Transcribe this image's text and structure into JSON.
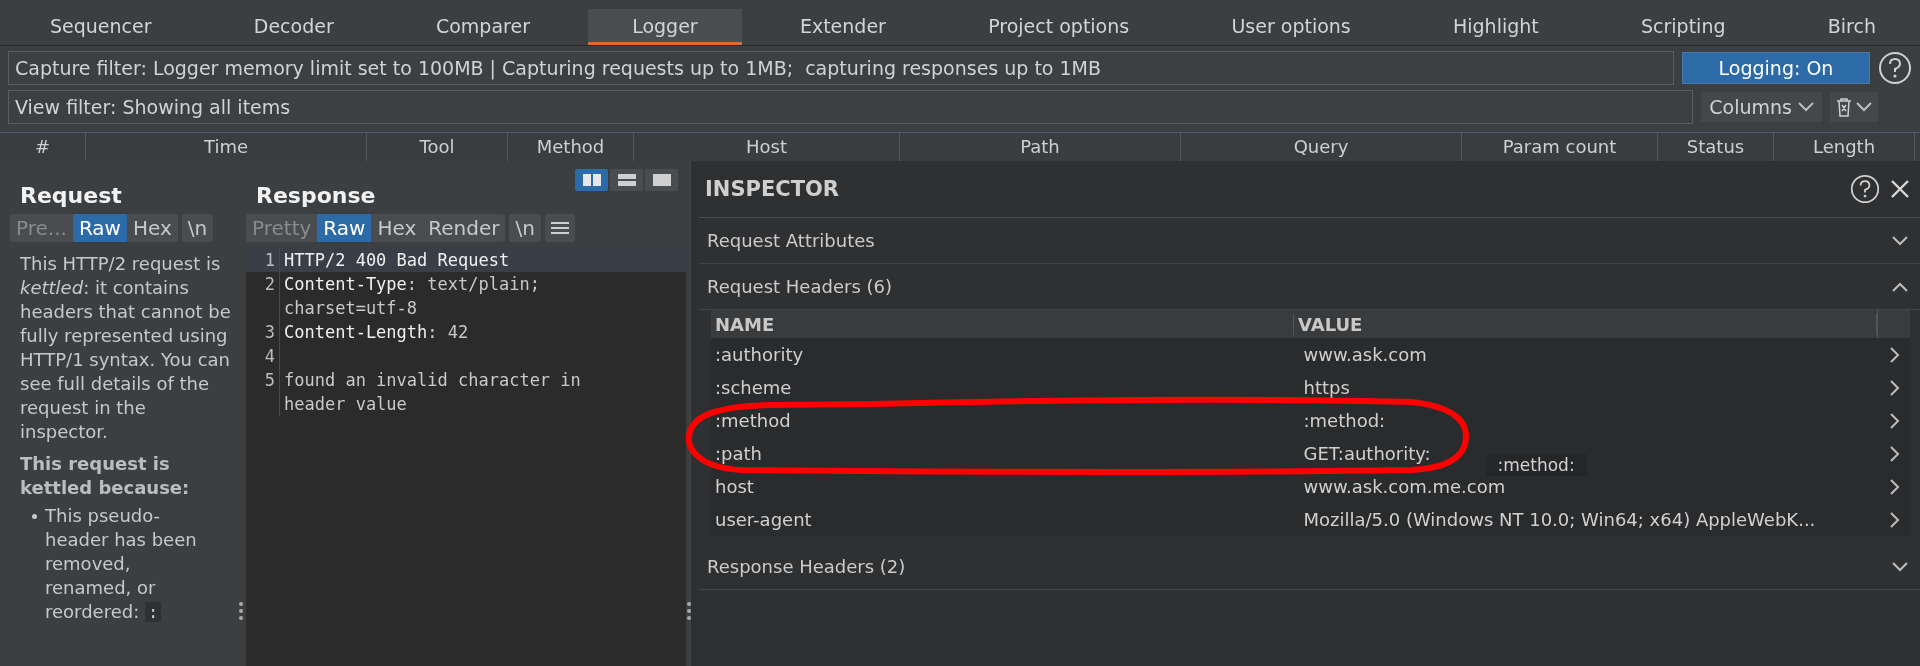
{
  "tabs_row_2": [
    {
      "label": "Sequencer",
      "selected": false
    },
    {
      "label": "Decoder",
      "selected": false
    },
    {
      "label": "Comparer",
      "selected": false
    },
    {
      "label": "Logger",
      "selected": true
    },
    {
      "label": "Extender",
      "selected": false
    },
    {
      "label": "Project options",
      "selected": false
    },
    {
      "label": "User options",
      "selected": false
    },
    {
      "label": "Highlight",
      "selected": false
    },
    {
      "label": "Scripting",
      "selected": false
    },
    {
      "label": "Birch",
      "selected": false
    }
  ],
  "capture_filter": "Capture filter: Logger memory limit set to 100MB | Capturing requests up to 1MB;  capturing responses up to 1MB",
  "logging_button": {
    "label": "Logging: On",
    "on": true
  },
  "view_filter": "View filter: Showing all items",
  "columns_button": "Columns",
  "table": {
    "columns": [
      "#",
      "Time",
      "Tool",
      "Method",
      "Host",
      "Path",
      "Query",
      "Param count",
      "Status",
      "Length"
    ]
  },
  "request": {
    "title": "Request",
    "tabs": [
      {
        "label": "Pre...",
        "selected": false
      },
      {
        "label": "Raw",
        "selected": true
      },
      {
        "label": "Hex",
        "selected": false
      },
      {
        "label": "\\n",
        "selected": false
      }
    ],
    "message": "This HTTP/2 request is *kettled*: it contains headers that cannot be fully represented using HTTP/1 syntax. You can see full details of the request in the inspector.",
    "reason_title": "This request is kettled because:",
    "reason": "This pseudo-header has been removed, renamed, or reordered:",
    "reason_code": ":"
  },
  "response": {
    "title": "Response",
    "view_modes": [
      {
        "kind": "split",
        "selected": true
      },
      {
        "kind": "stacked",
        "selected": false
      },
      {
        "kind": "single",
        "selected": false
      }
    ],
    "tabs": [
      {
        "label": "Pretty",
        "selected": false
      },
      {
        "label": "Raw",
        "selected": true
      },
      {
        "label": "Hex",
        "selected": false
      },
      {
        "label": "Render",
        "selected": false
      },
      {
        "label": "\\n",
        "selected": false
      }
    ],
    "lines": [
      {
        "number": "1",
        "key": "HTTP/2 400 Bad Request",
        "selected": true
      },
      {
        "number": "2",
        "key": "Content-Type",
        "value": ": text/plain;\ncharset=utf-8",
        "selected": false
      },
      {
        "number": "3",
        "key": "Content-Length",
        "value": ": 42",
        "selected": false
      },
      {
        "number": "4",
        "selected": false
      },
      {
        "number": "5",
        "value": "found an invalid character in\nheader value",
        "selected": false
      }
    ]
  },
  "inspector": {
    "title": "INSPECTOR",
    "sections": [
      {
        "title": "Request Attributes",
        "expanded": false
      },
      {
        "title": "Request Headers (6)",
        "expanded": true,
        "columns": [
          "NAME",
          "VALUE"
        ],
        "rows": [
          {
            "name": ":authority",
            "value": "www.ask.com"
          },
          {
            "name": ":scheme",
            "value": "https"
          },
          {
            "name": ":method",
            "value": ":method:"
          },
          {
            "name": ":path",
            "value": "GET:authority:"
          },
          {
            "name": "host",
            "value": "www.ask.com.me.com"
          },
          {
            "name": "user-agent",
            "value": "Mozilla/5.0 (Windows NT 10.0; Win64; x64) AppleWebK..."
          }
        ]
      },
      {
        "title": "Response Headers (2)",
        "expanded": false
      }
    ],
    "tooltip": ":method:"
  }
}
